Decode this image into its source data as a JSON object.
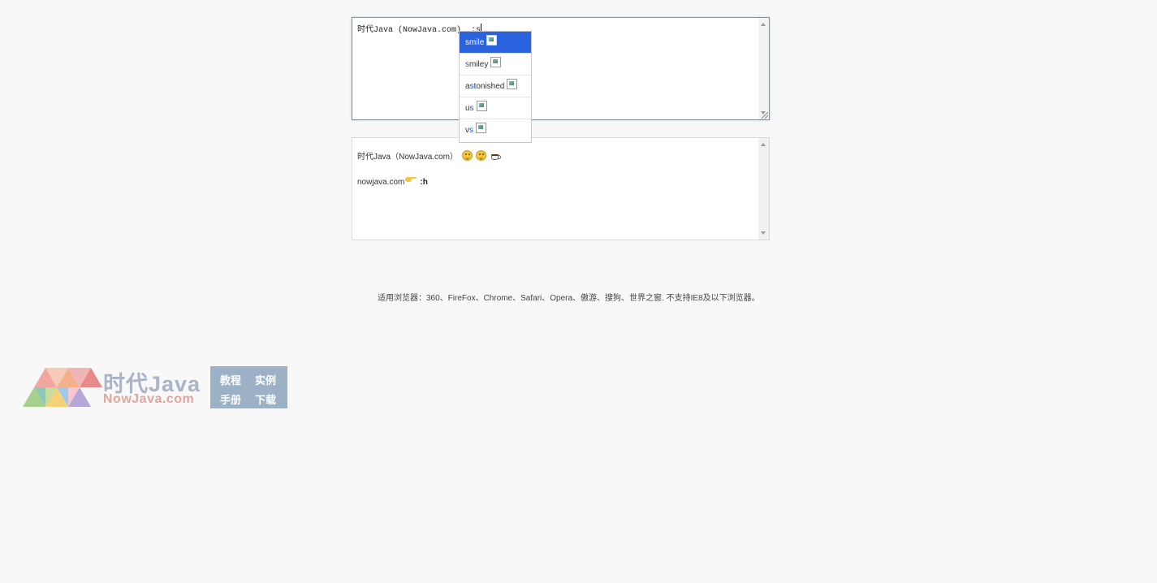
{
  "editor": {
    "text": "时代Java (NowJava.com)  :s"
  },
  "autocomplete": {
    "items": [
      {
        "highlight": "s",
        "rest": "mile",
        "selected": true
      },
      {
        "highlight": "s",
        "rest": "miley",
        "selected": false
      },
      {
        "prefix": "a",
        "highlight": "s",
        "rest": "tonished",
        "selected": false
      },
      {
        "prefix": "u",
        "highlight": "s",
        "rest": "",
        "selected": false
      },
      {
        "prefix": "v",
        "highlight": "s",
        "rest": "",
        "selected": false
      }
    ]
  },
  "preview": {
    "line1_text": "时代Java（NowJava.com）",
    "line1_icons": [
      "smile-emoji",
      "smiley-emoji",
      "coffee-emoji"
    ],
    "line2_text": "nowjava.com",
    "line2_icon": "pointing-hand-emoji",
    "line2_code": ":h"
  },
  "browser_note": "适用浏览器：360、FireFox、Chrome、Safari、Opera、傲游、搜狗、世界之窗. 不支持IE8及以下浏览器。",
  "logo": {
    "title": "时代Java",
    "subtitle": "NowJava.com",
    "box": [
      "教程",
      "实例",
      "手册",
      "下载"
    ]
  },
  "colors": {
    "accent": "#2b62dd",
    "focus_border": "#4da3d8",
    "background": "#f8f8f8"
  }
}
